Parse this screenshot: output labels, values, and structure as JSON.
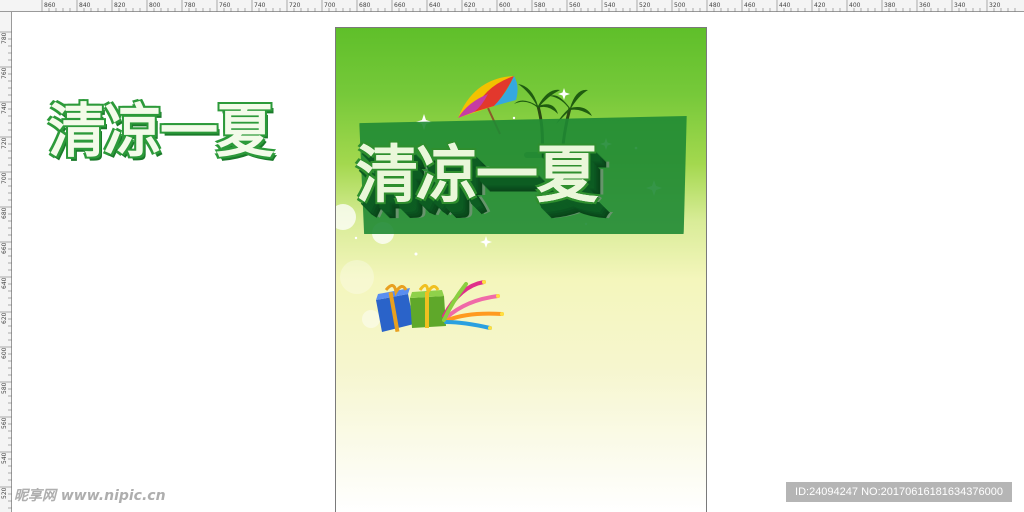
{
  "ruler": {
    "top_labels": [
      "860",
      "840",
      "820",
      "800",
      "780",
      "760",
      "740",
      "720",
      "700",
      "680",
      "660",
      "640",
      "620",
      "600",
      "580",
      "560",
      "540",
      "520",
      "500",
      "480",
      "460",
      "440",
      "420",
      "400",
      "380",
      "360",
      "340",
      "320"
    ],
    "left_labels": [
      "780",
      "760",
      "740",
      "720",
      "700",
      "680",
      "660",
      "640",
      "620",
      "600",
      "580",
      "560",
      "540",
      "520"
    ]
  },
  "artboard": {
    "title": "清凉一夏",
    "gradient_top": "#5fbf2a",
    "gradient_bottom": "#ffffff"
  },
  "side_title": "清凉一夏",
  "watermark": {
    "logo_text": "昵享网 www.nipic.cn",
    "id_text": "ID:24094247 NO:20170616181634376000"
  },
  "colors": {
    "title_green": "#2c9a3a",
    "extrude_green": "#0d5d22",
    "watermark_bg": "#787878"
  },
  "icons": [
    "umbrella-icon",
    "palm-tree-icon",
    "gift-box-icon",
    "firework-icon",
    "sparkle-icon"
  ]
}
